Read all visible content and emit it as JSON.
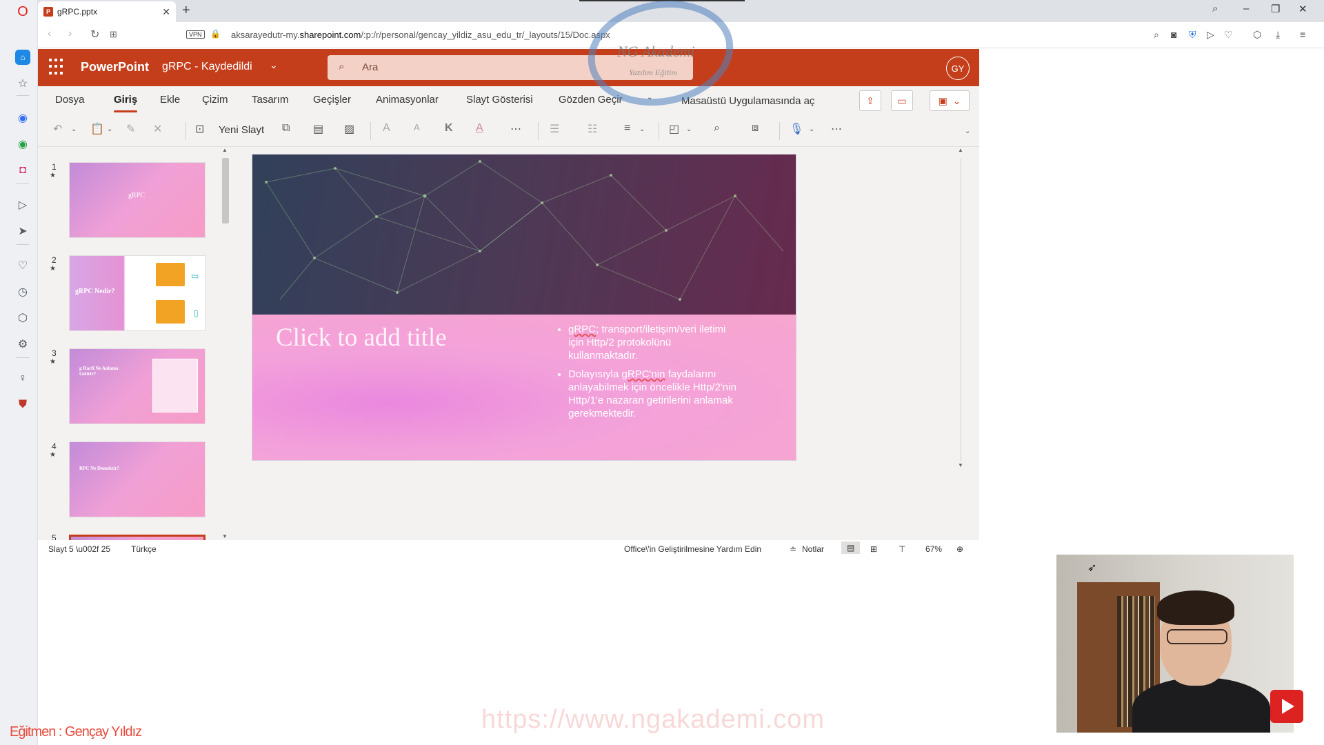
{
  "browser": {
    "tab_title": "gRPC.pptx",
    "url_prefix": "aksarayedutr-my.",
    "url_domain": "sharepoint.com",
    "url_path": "/:p:/r/personal/gencay_yildiz_asu_edu_tr/_layouts/15/Doc.aspx",
    "vpn_label": "VPN"
  },
  "rail_icons": [
    "home-icon",
    "bookmark-icon",
    "messenger-icon",
    "whatsapp-icon",
    "instagram-icon",
    "player-icon",
    "send-icon",
    "heart-icon",
    "clock-icon",
    "box-icon",
    "settings-icon",
    "bulb-icon",
    "shield-icon"
  ],
  "app": {
    "name": "PowerPoint",
    "doc_title": "gRPC - Kaydedildi",
    "search_placeholder": "Ara",
    "avatar_initials": "GY"
  },
  "menu": {
    "items": [
      "Dosya",
      "Giriş",
      "Ekle",
      "Çizim",
      "Tasarım",
      "Geçişler",
      "Animasyonlar",
      "Slayt Gösterisi",
      "Gözden Geçir",
      "Masaüstü Uygulamasında aç"
    ],
    "active": "Giriş"
  },
  "ribbon": {
    "new_slide_label": "Yeni Slayt"
  },
  "thumbnails": [
    {
      "number": "1",
      "title": "gRPC"
    },
    {
      "number": "2",
      "title": "gRPC Nedir?"
    },
    {
      "number": "3",
      "title": "g Harfi Ne Anlama Gelirir?"
    },
    {
      "number": "4",
      "title": "RPC Ne Demektir?"
    },
    {
      "number": "5",
      "title": ""
    }
  ],
  "slide": {
    "title_placeholder": "Click to add title",
    "bullet1_a": "gRPC",
    "bullet1_b": "; transport/iletişim/veri iletimi için Http/2 protokolünü kullanmaktadır.",
    "bullet2_a": "Dolayısıyla ",
    "bullet2_b": "gRPC'nin",
    "bullet2_c": " faydalarını anlayabilmek için öncelikle Http/2'nin Http/1'e nazaran getirilerini anlamak gerekmektedir."
  },
  "status": {
    "slide_position": "Slayt 5 \\u002f 25",
    "language": "Türkçe",
    "help": "Office\\'in Geliştirilmesine Yardım Edin",
    "notes": "Notlar",
    "zoom": "67%"
  },
  "overlay": {
    "watermark_title": "NG Akademi",
    "watermark_subtitle": "Yazılım Eğitim",
    "site_url": "https://www.ngakademi.com",
    "instructor": "Eğitmen : Gençay Yıldız"
  },
  "colors": {
    "accent": "#c43e1c",
    "slide_pink": "#f6a9d4",
    "slide_dark": "#4a3a56"
  }
}
